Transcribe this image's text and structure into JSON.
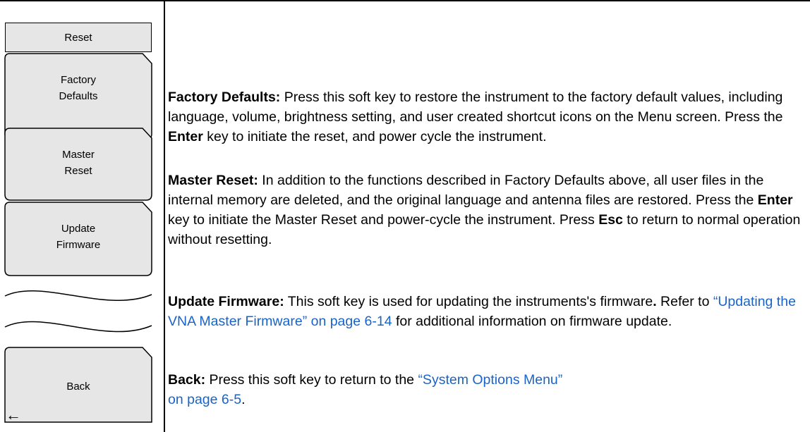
{
  "menu": {
    "title": "Reset",
    "keys": [
      {
        "line1": "Factory",
        "line2": "Defaults"
      },
      {
        "line1": "Master",
        "line2": "Reset"
      },
      {
        "line1": "Update",
        "line2": "Firmware"
      },
      {
        "line1": "Back",
        "line2": ""
      }
    ],
    "back_arrow": "←"
  },
  "descriptions": {
    "factory": {
      "term": "Factory Defaults:",
      "text1": " Press this soft key to restore the instrument to the factory default values, including language, volume, brightness setting, and user created shortcut icons on the Menu screen. Press the ",
      "bold1": "Enter",
      "text2": " key to initiate the reset, and power cycle the instrument."
    },
    "master": {
      "term": "Master Reset:",
      "text1": " In addition to the functions described in Factory Defaults above, all user files in the internal memory are deleted, and the original language and antenna files are restored. Press the ",
      "bold1": "Enter",
      "text2": " key to initiate the Master Reset and power-cycle the instrument. Press ",
      "bold2": "Esc",
      "text3": " to return to normal operation without resetting."
    },
    "update": {
      "term": "Update Firmware:",
      "text1": " This soft key is used for updating the instruments's firmware",
      "bold_dot": ".",
      "text2": " Refer to ",
      "link": "“Updating the VNA Master Firmware” on page 6-14",
      "text3": " for additional information on firmware update."
    },
    "back": {
      "term": "Back:",
      "text1": " Press this soft key to return to the ",
      "link1": "“System Options Menu”",
      "link2": "on page 6-5",
      "text2": "."
    }
  }
}
